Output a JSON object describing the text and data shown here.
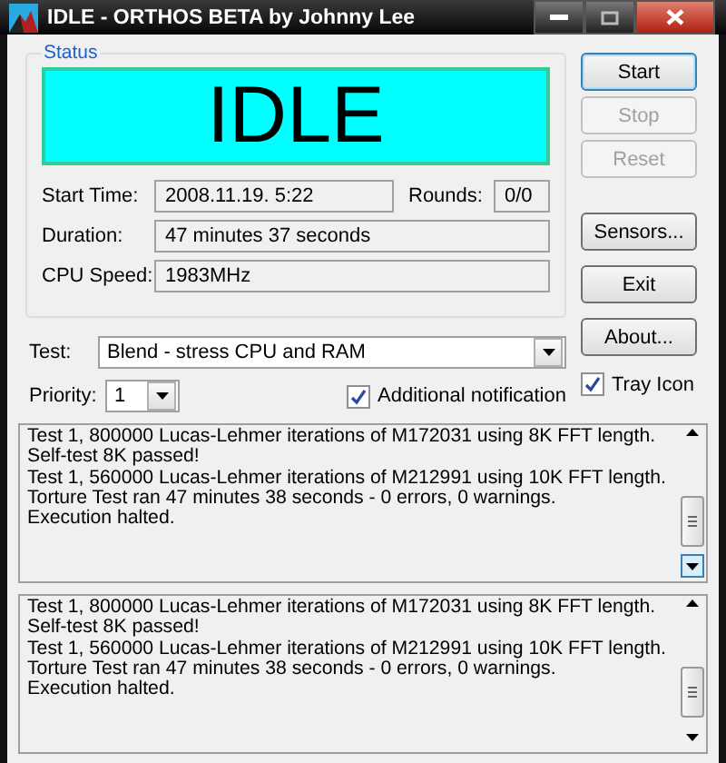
{
  "window": {
    "title": "IDLE - ORTHOS BETA by Johnny Lee"
  },
  "status": {
    "legend": "Status",
    "display": "IDLE",
    "start_time": {
      "label": "Start Time:",
      "value": "2008.11.19. 5:22"
    },
    "rounds": {
      "label": "Rounds:",
      "value": "0/0"
    },
    "duration": {
      "label": "Duration:",
      "value": "47 minutes 37 seconds"
    },
    "cpu_speed": {
      "label": "CPU Speed:",
      "value": "1983MHz"
    }
  },
  "run_buttons": [
    {
      "label": "Start",
      "disabled": false,
      "default": true
    },
    {
      "label": "Stop",
      "disabled": true,
      "default": false
    },
    {
      "label": "Reset",
      "disabled": true,
      "default": false
    }
  ],
  "tool_buttons": [
    {
      "label": "Sensors...",
      "disabled": false,
      "default": false
    },
    {
      "label": "Exit",
      "disabled": false,
      "default": false
    },
    {
      "label": "About...",
      "disabled": false,
      "default": false
    }
  ],
  "test": {
    "label": "Test:",
    "value": "Blend - stress CPU and RAM"
  },
  "priority": {
    "label": "Priority:",
    "value": "1"
  },
  "options": [
    {
      "label": "Additional notification",
      "checked": true
    },
    {
      "label": "Tray Icon",
      "checked": true
    }
  ],
  "logs": [
    {
      "lines": [
        "Test 1, 800000 Lucas-Lehmer iterations of M172031 using 8K FFT length.",
        "Self-test 8K passed!",
        "Test 1, 560000 Lucas-Lehmer iterations of M212991 using 10K FFT length.",
        "Torture Test ran 47 minutes 38 seconds - 0 errors, 0 warnings.",
        "Execution halted."
      ]
    },
    {
      "lines": [
        "Test 1, 800000 Lucas-Lehmer iterations of M172031 using 8K FFT length.",
        "Self-test 8K passed!",
        "Test 1, 560000 Lucas-Lehmer iterations of M212991 using 10K FFT length.",
        "Torture Test ran 47 minutes 38 seconds - 0 errors, 0 warnings.",
        "Execution halted."
      ]
    }
  ]
}
